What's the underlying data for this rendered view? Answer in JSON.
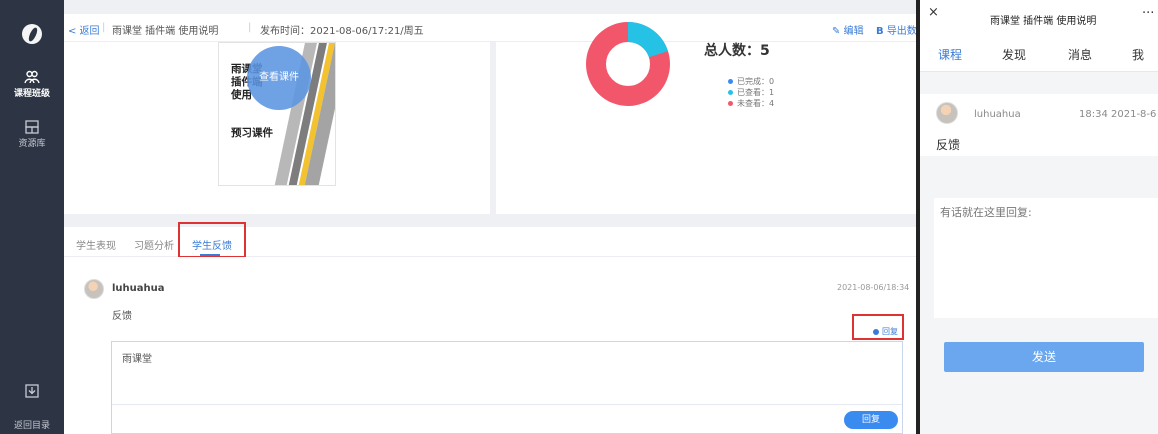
{
  "sidebar": {
    "items": [
      {
        "label": "课程班级",
        "icon": "class-icon"
      },
      {
        "label": "资源库",
        "icon": "library-icon"
      }
    ],
    "bottom": [
      {
        "label": "",
        "icon": "download-icon"
      },
      {
        "label": "返回目录",
        "icon": ""
      }
    ]
  },
  "topbar": {
    "back": "< 返回",
    "crumb": "雨课堂 插件端 使用说明",
    "pubtime": "发布时间：2021-08-06/17:21/周五",
    "edit": "编辑",
    "export": "导出数"
  },
  "courseware": {
    "cover_lines": [
      "雨课堂",
      "插件端",
      "使用",
      "预习课件"
    ],
    "view_button": "查看课件"
  },
  "stats": {
    "total_label": "总人数：5",
    "legend": [
      {
        "label": "已完成：0",
        "color": "#3a8bf0"
      },
      {
        "label": "已查看：1",
        "color": "#25c2e6"
      },
      {
        "label": "未查看：4",
        "color": "#f2566b"
      }
    ],
    "donut": {
      "viewed_fraction": 0.2,
      "unviewed_fraction": 0.8
    }
  },
  "tabs": [
    "学生表现",
    "习题分析",
    "学生反馈"
  ],
  "feedback": {
    "user": "luhuahua",
    "time": "2021-08-06/18:34",
    "text": "反馈",
    "reply_link": "回复",
    "reply_text": "雨课堂",
    "reply_button": "回复"
  },
  "mobile": {
    "title": "雨课堂 插件端 使用说明",
    "close": "×",
    "more": "···",
    "nav": [
      "课程",
      "发现",
      "消息",
      "我"
    ],
    "message": {
      "user": "luhuahua",
      "time": "18:34 2021-8-6",
      "text": "反馈"
    },
    "reply_placeholder": "有话就在这里回复:",
    "send": "发送"
  },
  "colors": {
    "accent": "#3a7bd5",
    "sidebar": "#2d3443",
    "highlight": "#dd3333"
  }
}
